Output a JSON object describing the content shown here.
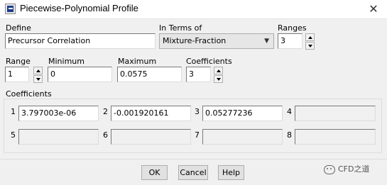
{
  "window": {
    "title": "Piecewise-Polynomial Profile",
    "close_icon": "close-icon",
    "close_glyph": "✕"
  },
  "define": {
    "label": "Define",
    "value": "Precursor Correlation"
  },
  "in_terms_of": {
    "label": "In Terms of",
    "value": "Mixture-Fraction"
  },
  "ranges": {
    "label": "Ranges",
    "value": "3"
  },
  "range": {
    "label": "Range",
    "value": "1"
  },
  "minimum": {
    "label": "Minimum",
    "value": "0"
  },
  "maximum": {
    "label": "Maximum",
    "value": "0.0575"
  },
  "coefficients_count": {
    "label": "Coefficients",
    "value": "3"
  },
  "coefficients_group": {
    "label": "Coefficients",
    "items": [
      {
        "index": "1",
        "value": "3.797003e-06"
      },
      {
        "index": "2",
        "value": "-0.001920161"
      },
      {
        "index": "3",
        "value": "0.05277236"
      },
      {
        "index": "4",
        "value": ""
      },
      {
        "index": "5",
        "value": ""
      },
      {
        "index": "6",
        "value": ""
      },
      {
        "index": "7",
        "value": ""
      },
      {
        "index": "8",
        "value": ""
      }
    ]
  },
  "buttons": {
    "ok": "OK",
    "cancel": "Cancel",
    "help": "Help"
  },
  "watermark": {
    "text": "CFD之道"
  }
}
